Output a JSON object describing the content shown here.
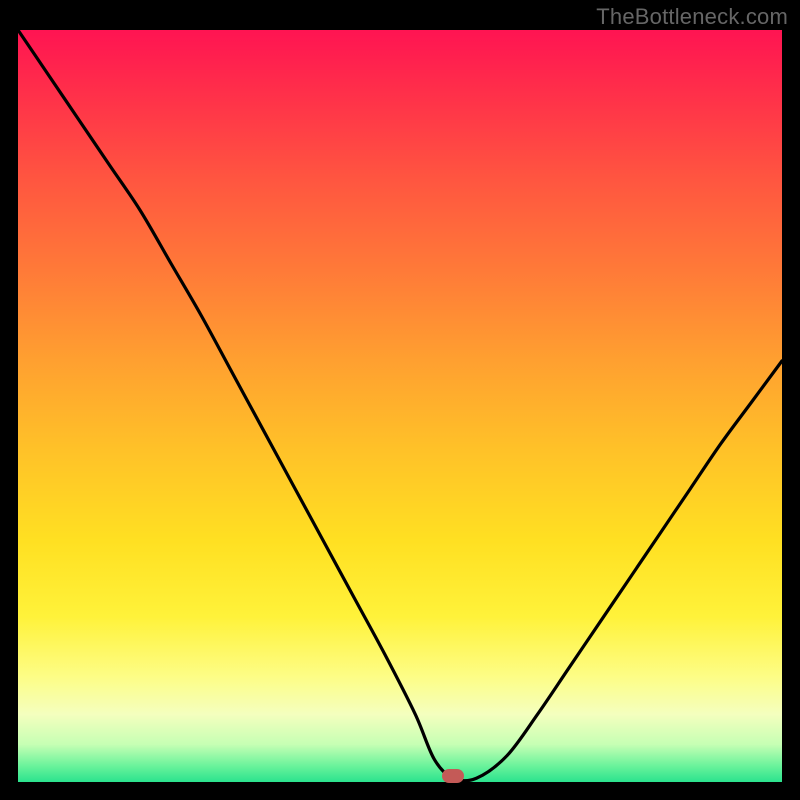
{
  "watermark": "TheBottleneck.com",
  "colors": {
    "frame": "#000000",
    "curve": "#000000",
    "marker": "#c45a57",
    "gradient_top": "#ff1452",
    "gradient_bottom": "#2be38e"
  },
  "chart_data": {
    "type": "line",
    "title": "",
    "xlabel": "",
    "ylabel": "",
    "xlim": [
      0,
      100
    ],
    "ylim": [
      0,
      100
    ],
    "x": [
      0,
      4,
      8,
      12,
      16,
      20,
      24,
      28,
      32,
      36,
      40,
      44,
      48,
      52,
      54.5,
      57,
      60,
      64,
      68,
      72,
      76,
      80,
      84,
      88,
      92,
      96,
      100
    ],
    "values": [
      100,
      94,
      88,
      82,
      76,
      69,
      62,
      54.5,
      47,
      39.5,
      32,
      24.5,
      17,
      9,
      3,
      0.5,
      0.5,
      3.5,
      9,
      15,
      21,
      27,
      33,
      39,
      45,
      50.5,
      56
    ],
    "note": "Values are bottleneck percentage; 0 is at bottom (green), 100 at top (red). Curve dips to a flat minimum near x≈55–60 where the marker sits.",
    "marker": {
      "x": 57,
      "y": 0.5
    }
  }
}
